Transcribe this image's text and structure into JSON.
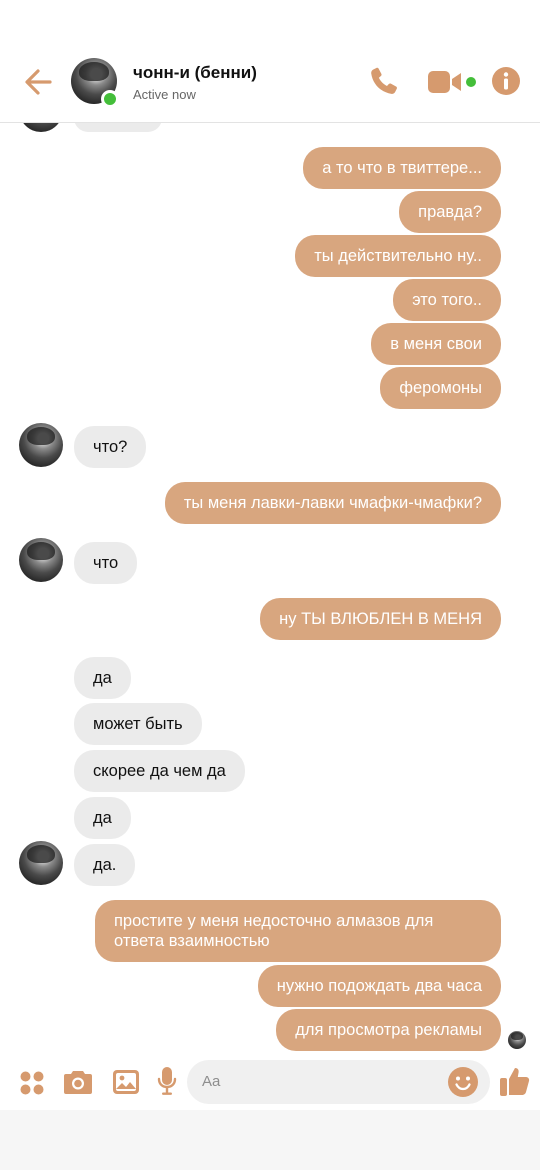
{
  "header": {
    "contact_name": "чонн-и (бенни)",
    "status": "Active now",
    "back_icon": "arrow-left-icon",
    "call_icon": "phone-icon",
    "video_icon": "video-camera-icon",
    "info_icon": "info-icon"
  },
  "messages": [
    {
      "side": "out",
      "text": "а то что в твиттере..."
    },
    {
      "side": "out",
      "text": "правда?"
    },
    {
      "side": "out",
      "text": "ты действительно ну.."
    },
    {
      "side": "out",
      "text": "это того.."
    },
    {
      "side": "out",
      "text": "в меня свои"
    },
    {
      "side": "out",
      "text": "феромоны"
    },
    {
      "side": "in",
      "text": "что?"
    },
    {
      "side": "out",
      "text": "ты меня лавки-лавки чмафки-чмафки?"
    },
    {
      "side": "in",
      "text": "что"
    },
    {
      "side": "out",
      "text": "ну ТЫ ВЛЮБЛЕН В МЕНЯ"
    },
    {
      "side": "in",
      "text": "да"
    },
    {
      "side": "in",
      "text": "может быть"
    },
    {
      "side": "in",
      "text": "скорее да чем да"
    },
    {
      "side": "in",
      "text": "да"
    },
    {
      "side": "in",
      "text": "да."
    },
    {
      "side": "out",
      "text": "простите у меня недосточно алмазов для ответа взаимностью"
    },
    {
      "side": "out",
      "text": "нужно подождать два часа"
    },
    {
      "side": "out",
      "text": "для просмотра рекламы"
    }
  ],
  "composer": {
    "placeholder": "Aa",
    "icons": [
      "apps-icon",
      "camera-icon",
      "gallery-icon",
      "microphone-icon",
      "emoji-icon",
      "thumbs-up-icon"
    ]
  },
  "colors": {
    "accent": "#d8a67f",
    "incoming_bubble": "#ebebeb",
    "online": "#44be3a"
  }
}
